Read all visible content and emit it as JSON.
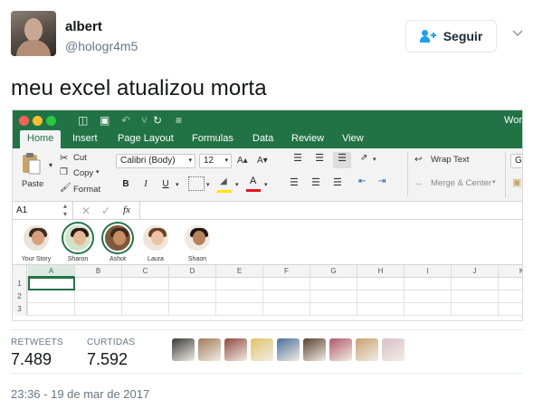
{
  "tweet": {
    "display_name": "albert",
    "handle": "@hologr4m5",
    "follow_label": "Seguir",
    "text": "meu excel atualizou morta",
    "timestamp": "23:36 - 19 de mar de 2017"
  },
  "stats": {
    "retweets_label": "RETWEETS",
    "retweets_value": "7.489",
    "likes_label": "CURTIDAS",
    "likes_value": "7.592",
    "liker_avatar_colors": [
      "#3a3a3a",
      "#a07c5a",
      "#8e4a3c",
      "#e0c36a",
      "#4a6f9a",
      "#5a4030",
      "#b05a6a",
      "#c9a070",
      "#d8c0c8"
    ]
  },
  "excel": {
    "app_title": "Wor",
    "tabs": [
      "Home",
      "Insert",
      "Page Layout",
      "Formulas",
      "Data",
      "Review",
      "View"
    ],
    "active_tab": "Home",
    "clipboard": {
      "paste": "Paste",
      "cut": "Cut",
      "copy": "Copy",
      "format": "Format"
    },
    "font_name": "Calibri (Body)",
    "font_size": "12",
    "format_buttons": {
      "bold": "B",
      "italic": "I",
      "underline": "U"
    },
    "wrap_text": "Wrap Text",
    "merge_center": "Merge & Center",
    "number_format_partial": "G",
    "name_box": "A1",
    "fx_label": "fx",
    "people": [
      {
        "label": "Your Story",
        "skin": "#d9a07f",
        "hair": "#3b2a1e",
        "bg": "#e9e3d8"
      },
      {
        "label": "Sharon",
        "skin": "#e8b896",
        "hair": "#2a1c14",
        "bg": "#cfe4c8"
      },
      {
        "label": "Ashot",
        "skin": "#c88c62",
        "hair": "#3a2a20",
        "bg": "#7d5a3a"
      },
      {
        "label": "Laura",
        "skin": "#ecc3a4",
        "hair": "#6b3f22",
        "bg": "#efe5da"
      },
      {
        "label": "Shaon",
        "skin": "#b9825e",
        "hair": "#1f1612",
        "bg": "#f1e9df"
      }
    ],
    "columns": [
      "A",
      "B",
      "C",
      "D",
      "E",
      "F",
      "G",
      "H",
      "I",
      "J",
      "K"
    ],
    "rows": [
      "1",
      "2",
      "3"
    ],
    "accent_color": "#217346"
  }
}
